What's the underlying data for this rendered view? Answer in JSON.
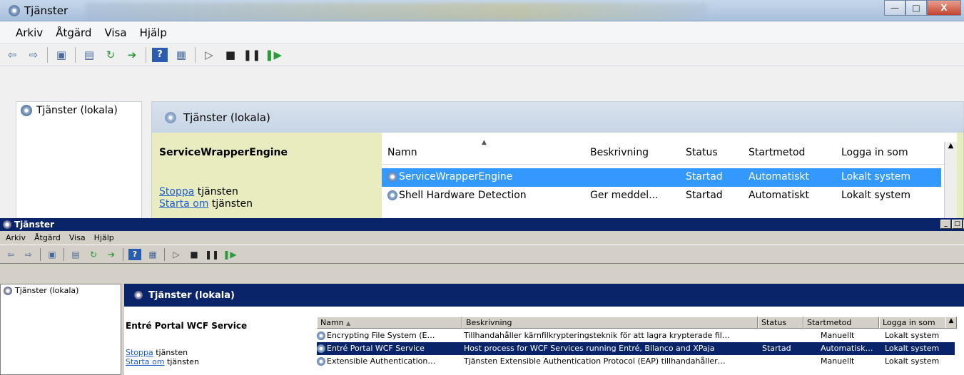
{
  "win1": {
    "title": "Tjänster",
    "menu": [
      "Arkiv",
      "Åtgärd",
      "Visa",
      "Hjälp"
    ],
    "tree_node": "Tjänster (lokala)",
    "pane_header": "Tjänster (lokala)",
    "selected_service": "ServiceWrapperEngine",
    "stop_link": "Stoppa",
    "stop_suffix": " tjänsten",
    "restart_link": "Starta om",
    "restart_suffix": " tjänsten",
    "columns": [
      "Namn",
      "Beskrivning",
      "Status",
      "Startmetod",
      "Logga in som"
    ],
    "rows": [
      {
        "name": "ServiceWrapperEngine",
        "desc": "",
        "status": "Startad",
        "start": "Automatiskt",
        "logon": "Lokalt system"
      },
      {
        "name": "Shell Hardware Detection",
        "desc": "Ger meddel...",
        "status": "Startad",
        "start": "Automatiskt",
        "logon": "Lokalt system"
      }
    ]
  },
  "win2": {
    "title": "Tjänster",
    "menu": [
      "Arkiv",
      "Åtgärd",
      "Visa",
      "Hjälp"
    ],
    "tree_node": "Tjänster (lokala)",
    "pane_header": "Tjänster (lokala)",
    "selected_service": "Entré Portal WCF Service",
    "stop_link": "Stoppa",
    "stop_suffix": " tjänsten",
    "restart_link": "Starta om",
    "restart_suffix": " tjänsten",
    "columns": [
      "Namn",
      "Beskrivning",
      "Status",
      "Startmetod",
      "Logga in som"
    ],
    "rows": [
      {
        "name": "Encrypting File System (E…",
        "desc": "Tillhandahåller kärnfilkrypteringsteknik för att lagra krypterade fil…",
        "status": "",
        "start": "Manuellt",
        "logon": "Lokalt system"
      },
      {
        "name": "Entré Portal WCF Service",
        "desc": "Host process for WCF Services running Entré, Bilanco and XPaja",
        "status": "Startad",
        "start": "Automatisk…",
        "logon": "Lokalt system"
      },
      {
        "name": "Extensible Authentication…",
        "desc": "Tjänsten Extensible Authentication Protocol (EAP) tillhandahåller…",
        "status": "",
        "start": "Manuellt",
        "logon": "Lokalt system"
      }
    ]
  },
  "colors": {
    "win7_selection": "#3399ff",
    "classic_title": "#0a246a",
    "details_bg": "#e8ecbe"
  }
}
